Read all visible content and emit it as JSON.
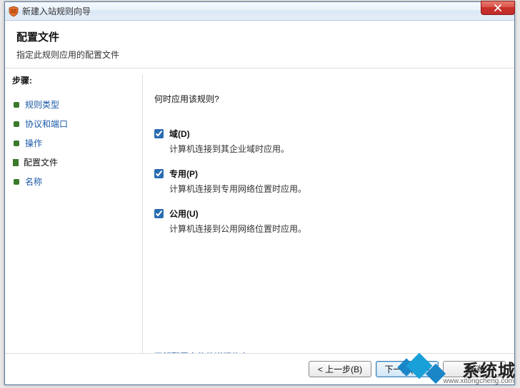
{
  "window": {
    "title": "新建入站规则向导",
    "close_label": "X"
  },
  "header": {
    "title": "配置文件",
    "subtitle": "指定此规则应用的配置文件"
  },
  "sidebar": {
    "steps_label": "步骤:",
    "items": [
      {
        "label": "规则类型"
      },
      {
        "label": "协议和端口"
      },
      {
        "label": "操作"
      },
      {
        "label": "配置文件"
      },
      {
        "label": "名称"
      }
    ],
    "current_index": 3
  },
  "main": {
    "question": "何时应用该规则?",
    "options": [
      {
        "label": "域(D)",
        "desc": "计算机连接到其企业域时应用。",
        "checked": true
      },
      {
        "label": "专用(P)",
        "desc": "计算机连接到专用网络位置时应用。",
        "checked": true
      },
      {
        "label": "公用(U)",
        "desc": "计算机连接到公用网络位置时应用。",
        "checked": true
      }
    ],
    "more_link": "了解配置文件的详细信息"
  },
  "footer": {
    "back": "< 上一步(B)",
    "next": "下一步(N) >",
    "cancel": "取消"
  },
  "watermark": {
    "brand": "系统城",
    "url": "www.xitongcheng.com"
  }
}
